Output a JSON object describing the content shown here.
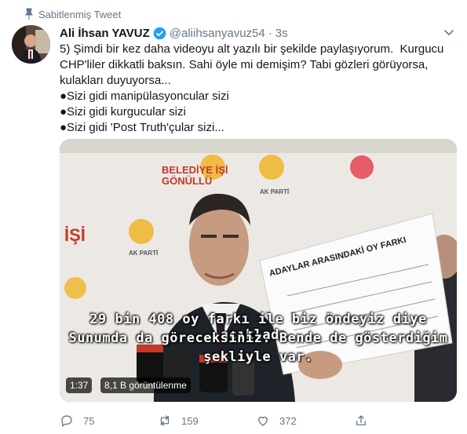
{
  "pinned": {
    "label": "Sabitlenmiş Tweet"
  },
  "author": {
    "name": "Ali İhsan YAVUZ",
    "handle": "@aliihsanyavuz54",
    "separator": "·",
    "time": "3s"
  },
  "tweet": {
    "lines": [
      "5) Şimdi bir kez daha videoyu alt yazılı bir şekilde paylaşıyorum.  Kurgucu",
      "CHP'liler dikkatli baksın. Sahi öyle mi demişim? Tabi gözleri görüyorsa,",
      "kulakları duyuyorsa...",
      "●Sizi gidi manipülasyoncular sizi",
      "●Sizi gidi kurgucular sizi",
      "●Sizi gidi 'Post Truth'çular sizi..."
    ]
  },
  "video": {
    "backdrop_text_1": "BELEDİYE İŞİ",
    "backdrop_text_2": "GÖNÜLLÜ",
    "backdrop_text_3": "AK PARTİ",
    "backdrop_text_4": "İŞİ",
    "backdrop_text_5": "AK PARTİ",
    "doc_title": "ADAYLAR ARASINDAKİ OY FARKI",
    "subtitle_1": "29 bin 408 oy farkı ile biz öndeyiz diye açıkladı.",
    "subtitle_2": "Sunumda da göreceksiniz. Bende de gösterdiğim",
    "subtitle_3": "şekliyle var.",
    "duration": "1:37",
    "views": "8,1 B görüntülenme"
  },
  "actions": {
    "reply_count": "75",
    "retweet_count": "159",
    "like_count": "372"
  },
  "colors": {
    "verified": "#1da1f2",
    "muted": "#657786",
    "text": "#14171a"
  }
}
